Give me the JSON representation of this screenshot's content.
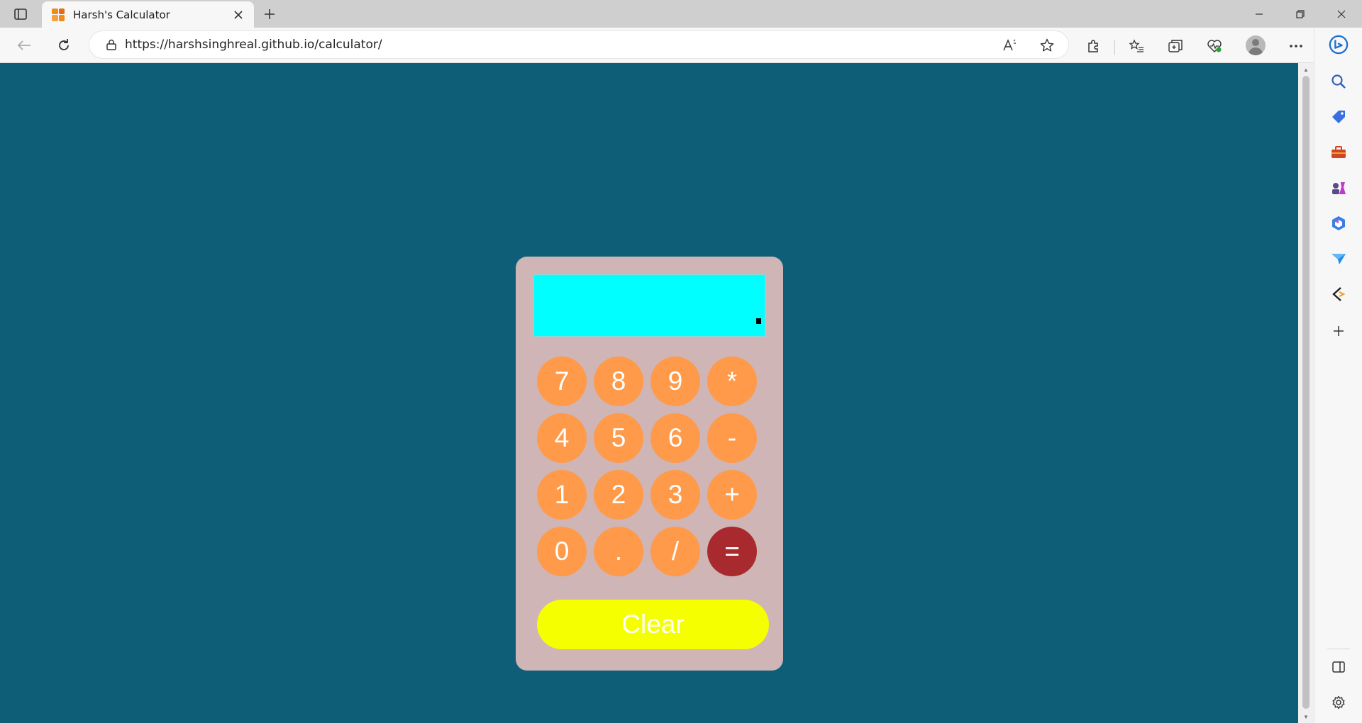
{
  "browser": {
    "tab": {
      "title": "Harsh's Calculator"
    },
    "address": {
      "url": "https://harshsinghreal.github.io/calculator/"
    }
  },
  "page": {
    "background": "#0e5e78"
  },
  "calculator": {
    "display_value": "",
    "colors": {
      "body": "#cfb5b5",
      "display": "#00ffff",
      "key": "#ff9a4a",
      "equals": "#a82a2e",
      "clear": "#f5ff00"
    },
    "keys": [
      [
        "7",
        "8",
        "9",
        "*"
      ],
      [
        "4",
        "5",
        "6",
        "-"
      ],
      [
        "1",
        "2",
        "3",
        "+"
      ],
      [
        "0",
        ".",
        "/",
        "="
      ]
    ],
    "clear_label": "Clear"
  }
}
